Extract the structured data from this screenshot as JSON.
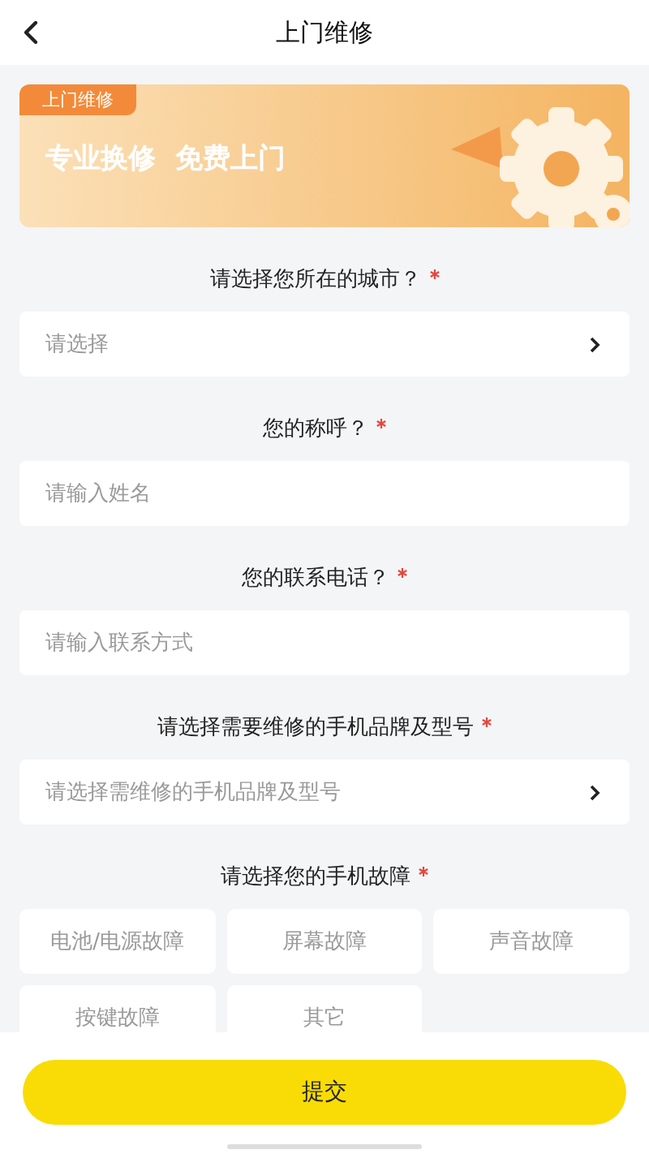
{
  "header": {
    "title": "上门维修"
  },
  "banner": {
    "tag": "上门维修",
    "slogan": "专业换修  免费上门"
  },
  "questions": [
    {
      "kind": "select",
      "label": "请选择您所在的城市？",
      "required": true,
      "placeholder": "请选择"
    },
    {
      "kind": "input",
      "label": "您的称呼？",
      "required": true,
      "placeholder": "请输入姓名"
    },
    {
      "kind": "input",
      "label": "您的联系电话？",
      "required": true,
      "placeholder": "请输入联系方式"
    },
    {
      "kind": "select",
      "label": "请选择需要维修的手机品牌及型号",
      "required": true,
      "placeholder": "请选择需维修的手机品牌及型号"
    },
    {
      "kind": "chips",
      "label": "请选择您的手机故障",
      "required": true,
      "options": [
        {
          "label": "电池/电源故障",
          "selected": false
        },
        {
          "label": "屏幕故障",
          "selected": false
        },
        {
          "label": "声音故障",
          "selected": false
        },
        {
          "label": "按键故障",
          "selected": false
        },
        {
          "label": "其它",
          "selected": false
        }
      ]
    }
  ],
  "submit": "提交"
}
